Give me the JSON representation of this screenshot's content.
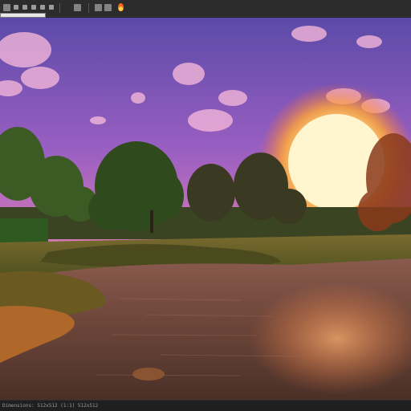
{
  "toolbar": {
    "title": "",
    "icons": [
      "menu-icon",
      "file-icon",
      "save-icon",
      "layers-icon",
      "brush-icon",
      "crop-icon",
      "zoom-icon",
      "eye-icon",
      "settings-icon",
      "flame-icon"
    ]
  },
  "canvas": {
    "subject": "sunset over river landscape",
    "colors": {
      "sky_top": "#6a4fb0",
      "sky_mid": "#b46ac8",
      "sky_horizon": "#ff8a4a",
      "sun": "#fff2c0",
      "sun_glow": "#ff7a2a",
      "trees": "#2e4a1e",
      "grass": "#6b6a2a",
      "water": "#6e4a3c"
    }
  },
  "status": {
    "text": "Dimensions: 512x512 (1:1) 512x512"
  }
}
